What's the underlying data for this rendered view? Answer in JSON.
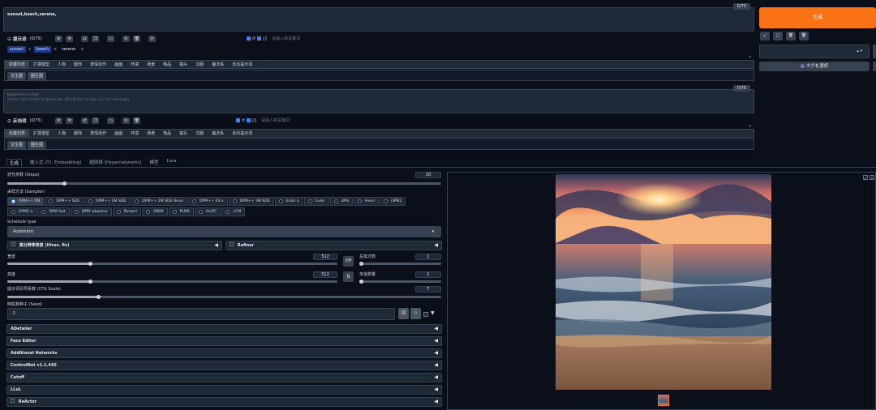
{
  "prompt": {
    "text": "sunset,beach,serene,",
    "counter": "0/75",
    "header_label": "提示词",
    "header_count": "(0/75)",
    "tag_input_placeholder": "请输入新关键词",
    "chips": [
      "sunset",
      "beach",
      "serene"
    ],
    "chip_remove": "×",
    "category_tabs": [
      "收藏列表",
      "扩展模型",
      "人物",
      "服饰",
      "表情动作",
      "画面",
      "环境",
      "场景",
      "物品",
      "镜头",
      "汉服",
      "魔法系",
      "反向提示词"
    ],
    "sub_buttons": [
      "文生图",
      "图生图"
    ]
  },
  "negative": {
    "placeholder": "Negative prompt\n(Press Ctrl+Enter to generate, Alt+Enter to skip, Esc to interrupt)",
    "counter": "0/75",
    "header_label": "反向词",
    "header_count": "(0/75)",
    "tag_input_placeholder": "请输入新关键词",
    "category_tabs": [
      "收藏列表",
      "扩展模型",
      "人物",
      "服饰",
      "表情动作",
      "画面",
      "环境",
      "场景",
      "物品",
      "镜头",
      "汉服",
      "魔法系",
      "反向提示词"
    ],
    "sub_buttons": [
      "文生图",
      "图生图"
    ]
  },
  "right_panel": {
    "generate_label": "生成",
    "tag_select_label": "タグを選択",
    "tool_buttons": [
      "↙",
      "▢",
      "🗑",
      "🗑"
    ],
    "dropdown_arrows": "▴ ▾"
  },
  "main_tabs": [
    "生成",
    "嵌入式 (T.I. Embedding)",
    "超网络 (Hypernetworks)",
    "模型",
    "Lora"
  ],
  "steps": {
    "label": "迭代步数 (Steps)",
    "value": "20",
    "fraction": 0.13
  },
  "sampler": {
    "label": "采样方法 (Sampler)",
    "options": [
      "DPM++ 2M",
      "DPM++ SDE",
      "DPM++ 2M SDE",
      "DPM++ 2M SDE Heun",
      "DPM++ 2S a",
      "DPM++ 3M SDE",
      "Euler a",
      "Euler",
      "LMS",
      "Heun",
      "DPM2",
      "DPM2 a",
      "DPM fast",
      "DPM adaptive",
      "Restart",
      "DDIM",
      "PLMS",
      "UniPC",
      "LCM"
    ],
    "selected": "DPM++ 2M"
  },
  "schedule": {
    "label": "Schedule type",
    "value": "Automatic"
  },
  "hires_label": "高分辨率修复 (Hires. fix)",
  "refiner_label": "Refiner",
  "width": {
    "label": "宽度",
    "value": "512",
    "fraction": 0.25
  },
  "height": {
    "label": "高度",
    "value": "512",
    "fraction": 0.25
  },
  "batch_count": {
    "label": "总批次数",
    "value": "1",
    "fraction": 0.0
  },
  "batch_size": {
    "label": "单批数量",
    "value": "1",
    "fraction": 0.0
  },
  "off_label": "Off",
  "swap_label": "⇅",
  "cfg": {
    "label": "提示词引导系数 (CFG Scale)",
    "value": "7",
    "fraction": 0.21
  },
  "seed": {
    "label": "随机数种子 (Seed)",
    "value": "-1"
  },
  "accordions": [
    "ADetailer",
    "Face Editor",
    "Additional Networks",
    "ControlNet v1.1.445",
    "Cutoff",
    "LLuL",
    "ReActor"
  ],
  "image": {
    "caption": "sunset beach"
  }
}
